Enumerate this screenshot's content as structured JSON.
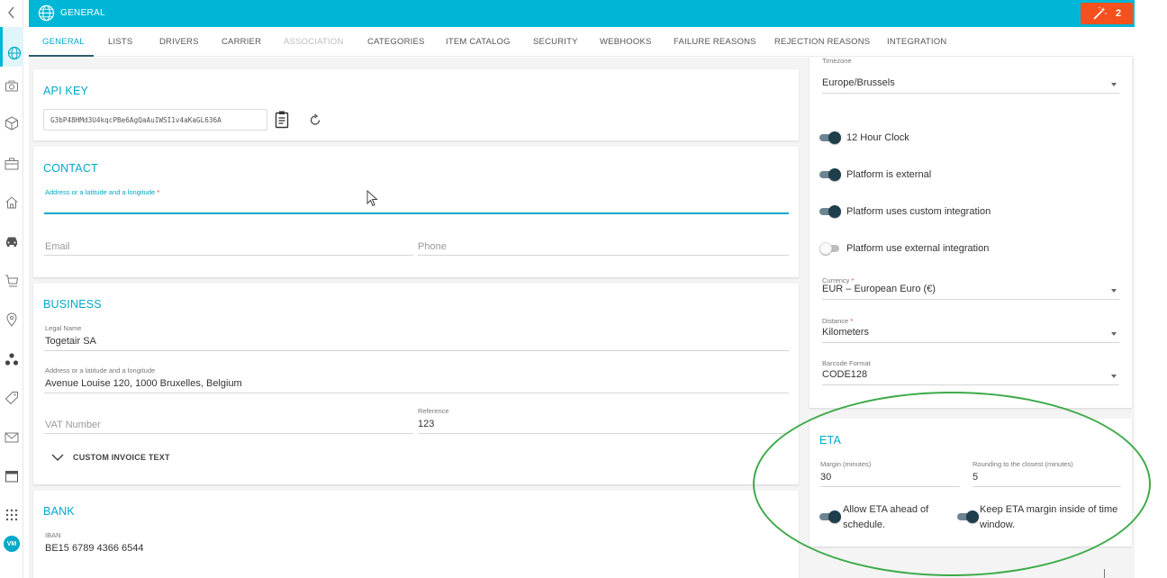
{
  "topbar": {
    "title": "General",
    "notification_count": "2",
    "accent": "#00b6d6",
    "notif_color": "#f4511e"
  },
  "tabs": [
    {
      "label": "GENERAL"
    },
    {
      "label": "LISTS"
    },
    {
      "label": "DRIVERS"
    },
    {
      "label": "CARRIER"
    },
    {
      "label": "ASSOCIATION"
    },
    {
      "label": "CATEGORIES"
    },
    {
      "label": "ITEM CATALOG"
    },
    {
      "label": "SECURITY"
    },
    {
      "label": "WEBHOOKS"
    },
    {
      "label": "FAILURE REASONS"
    },
    {
      "label": "REJECTION REASONS"
    },
    {
      "label": "INTEGRATION"
    }
  ],
  "rail": {
    "badge": "VM",
    "icons": [
      "chevron-left-icon",
      "globe-icon",
      "camera-icon",
      "cube-icon",
      "briefcase-icon",
      "home-icon",
      "car-icon",
      "cart-icon",
      "location-pin-icon",
      "network-icon",
      "tag-icon",
      "mail-icon",
      "calendar-icon",
      "grid-dots-icon"
    ]
  },
  "api": {
    "title": "API KEY",
    "key": "G3bP48HMd3U4kqcPBe6AgQaAuIWSI1v4aKaGL636A"
  },
  "contact": {
    "title": "CONTACT",
    "address_label": "Address or a latitude and a longitude",
    "email_placeholder": "Email",
    "phone_placeholder": "Phone"
  },
  "business": {
    "title": "BUSINESS",
    "legal_name_label": "Legal Name",
    "legal_name": "Togetair SA",
    "address_label": "Address or a latitude and a longitude",
    "address": "Avenue Louise 120, 1000 Bruxelles, Belgium",
    "vat_placeholder": "VAT Number",
    "reference_label": "Reference",
    "reference": "123",
    "custom_invoice": "CUSTOM INVOICE TEXT"
  },
  "bank": {
    "title": "BANK",
    "iban_label": "IBAN",
    "iban": "BE15 6789 4366 6544"
  },
  "settings": {
    "timezone_label": "Timezone",
    "timezone": "Europe/Brussels",
    "toggles": [
      {
        "label": "12 Hour Clock",
        "on": true
      },
      {
        "label": "Platform is external",
        "on": true
      },
      {
        "label": "Platform uses custom integration",
        "on": true
      },
      {
        "label": "Platform use external integration",
        "on": false
      }
    ],
    "currency_label": "Currency",
    "currency": "EUR – European Euro (€)",
    "distance_label": "Distance",
    "distance": "Kilometers",
    "barcode_label": "Barcode Format",
    "barcode": "CODE128"
  },
  "eta": {
    "title": "ETA",
    "margin_label": "Margin (minutes)",
    "margin": "30",
    "rounding_label": "Rounding to the closest (minutes)",
    "rounding": "5",
    "ahead_line1": "Allow ETA ahead of",
    "ahead_line2": "schedule.",
    "keep_line1": "Keep ETA margin inside of time",
    "keep_line2": "window."
  }
}
